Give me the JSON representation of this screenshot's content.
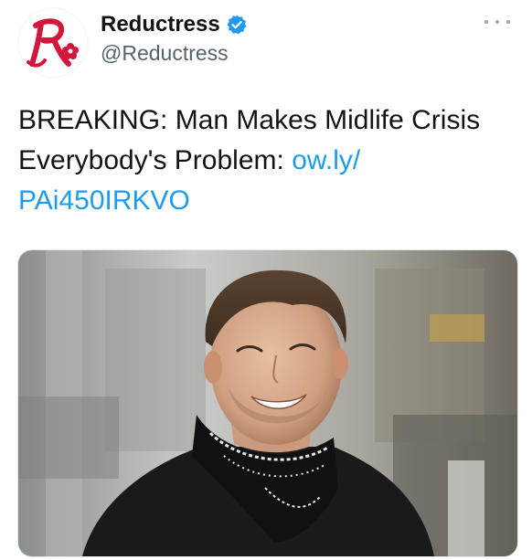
{
  "account": {
    "display_name": "Reductress",
    "handle": "@Reductress",
    "verified": true,
    "avatar_icon": "reductress-logo-icon",
    "accent_color": "#d3173c"
  },
  "more_icon": "more-horizontal-icon",
  "tweet": {
    "text": "BREAKING: Man Makes Midlife Crisis Everybody's Problem: ",
    "link_text": "ow.ly/\nPAi450IRKVO",
    "link_color": "#1d9bf0"
  },
  "media": {
    "kind": "photo",
    "subject": "smiling man in black jacket with paisley bandana around neck, blurred industrial background"
  }
}
